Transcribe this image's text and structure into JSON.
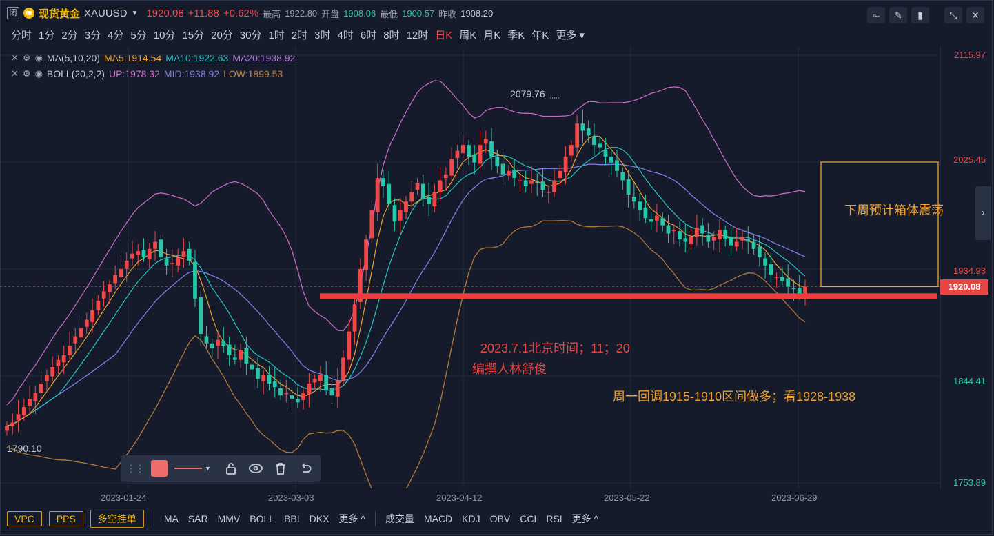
{
  "header": {
    "close_label": "闭",
    "symbol_name": "现货黄金",
    "symbol_code": "XAUUSD",
    "price": "1920.08",
    "change": "+11.88",
    "change_pct": "+0.62%",
    "high_label": "最高",
    "high": "1922.80",
    "open_label": "开盘",
    "open": "1908.06",
    "low_label": "最低",
    "low": "1900.57",
    "prev_label": "昨收",
    "prev": "1908.20"
  },
  "periods": [
    "分时",
    "1分",
    "2分",
    "3分",
    "4分",
    "5分",
    "10分",
    "15分",
    "20分",
    "30分",
    "1时",
    "2时",
    "3时",
    "4时",
    "6时",
    "8时",
    "12时",
    "日K",
    "周K",
    "月K",
    "季K",
    "年K",
    "更多"
  ],
  "active_period": "日K",
  "indicators": {
    "ma": {
      "name": "MA(5,10,20)",
      "ma5": "MA5:1914.54",
      "ma10": "MA10:1922.63",
      "ma20": "MA20:1938.92"
    },
    "boll": {
      "name": "BOLL(20,2,2)",
      "up": "UP:1978.32",
      "mid": "MID:1938.92",
      "low": "LOW:1899.53"
    }
  },
  "colors": {
    "up": "#f04848",
    "down": "#26c6a8",
    "ma5": "#f0a030",
    "ma10": "#26c6c6",
    "ma20": "#7f7fe8",
    "boll_up": "#c46ac4",
    "boll_low": "#b07a3a"
  },
  "price_axis": [
    "2115.97",
    "2025.45",
    "1934.93",
    "1844.41",
    "1753.89"
  ],
  "current_price": "1920.08",
  "date_axis": [
    "2023-01-24",
    "2023-03-03",
    "2023-04-12",
    "2023-05-22",
    "2023-06-29"
  ],
  "annotations": {
    "high_mark": "2079.76",
    "low_mark": "1790.10",
    "box_text": "下周预计箱体震荡",
    "timestamp": "2023.7.1北京时间；11；20",
    "author": "编撰人林舒俊",
    "strategy": "周一回调1915-1910区间做多；看1928-1938"
  },
  "bottom": {
    "buttons": [
      "VPC",
      "PPS",
      "多空挂单"
    ],
    "main_inds": [
      "MA",
      "SAR",
      "MMV",
      "BOLL",
      "BBI",
      "DKX",
      "更多 ^"
    ],
    "sub_inds": [
      "成交量",
      "MACD",
      "KDJ",
      "OBV",
      "CCI",
      "RSI",
      "更多 ^"
    ]
  },
  "chart_data": {
    "type": "candlestick",
    "ylim": [
      1753.89,
      2115.97
    ],
    "x_start": "2023-01-01",
    "x_end": "2023-06-30",
    "close": [
      1802,
      1805,
      1812,
      1818,
      1825,
      1830,
      1838,
      1845,
      1852,
      1858,
      1862,
      1870,
      1878,
      1885,
      1892,
      1900,
      1908,
      1916,
      1922,
      1930,
      1935,
      1942,
      1948,
      1950,
      1945,
      1952,
      1958,
      1945,
      1938,
      1940,
      1945,
      1950,
      1942,
      1910,
      1880,
      1872,
      1868,
      1875,
      1870,
      1862,
      1858,
      1866,
      1855,
      1850,
      1842,
      1845,
      1838,
      1835,
      1828,
      1830,
      1825,
      1822,
      1830,
      1838,
      1842,
      1845,
      1832,
      1828,
      1840,
      1860,
      1882,
      1905,
      1935,
      1960,
      1985,
      2012,
      2005,
      1990,
      1975,
      1985,
      1992,
      2000,
      2008,
      1995,
      1990,
      2000,
      2010,
      2015,
      2028,
      2035,
      2040,
      2030,
      2025,
      2040,
      2045,
      2030,
      2022,
      2015,
      2018,
      2012,
      2010,
      2005,
      2010,
      2008,
      2002,
      2000,
      2010,
      2018,
      2030,
      2040,
      2058,
      2052,
      2048,
      2040,
      2038,
      2030,
      2025,
      2018,
      2010,
      1998,
      1992,
      1985,
      1978,
      1975,
      1980,
      1972,
      1965,
      1968,
      1960,
      1958,
      1962,
      1970,
      1965,
      1958,
      1962,
      1968,
      1960,
      1955,
      1958,
      1962,
      1958,
      1952,
      1945,
      1938,
      1930,
      1928,
      1925,
      1920,
      1918,
      1914,
      1920
    ]
  }
}
